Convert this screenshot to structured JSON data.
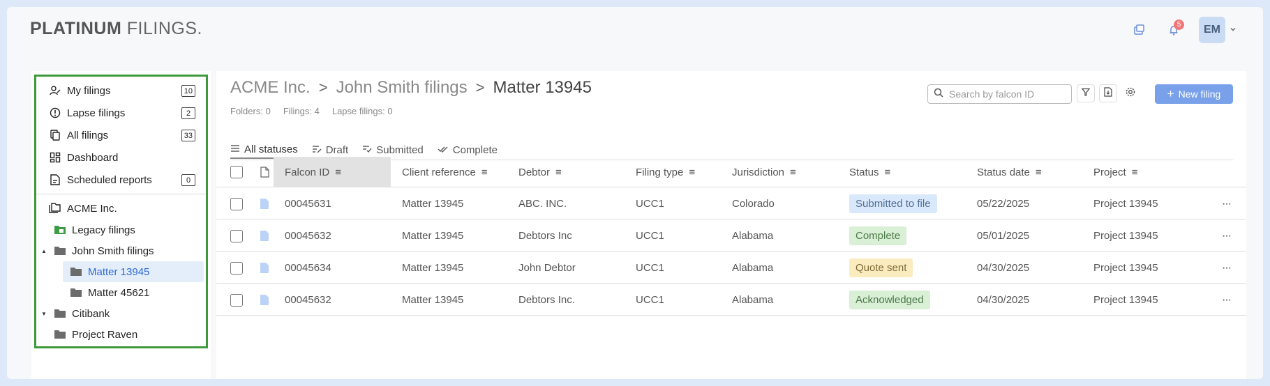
{
  "brand": {
    "bold": "PLATINUM",
    "light": "FILINGS",
    "dot": "."
  },
  "header": {
    "notification_count": "5",
    "avatar_initials": "EM"
  },
  "sidebar": {
    "nav": [
      {
        "label": "My filings",
        "count": "10",
        "icon": "user-edit-icon"
      },
      {
        "label": "Lapse filings",
        "count": "2",
        "icon": "alert-circle-icon"
      },
      {
        "label": "All filings",
        "count": "33",
        "icon": "copy-icon"
      },
      {
        "label": "Dashboard",
        "count": "",
        "icon": "grid-icon"
      },
      {
        "label": "Scheduled reports",
        "count": "0",
        "icon": "report-icon"
      }
    ],
    "tree": [
      {
        "label": "ACME Inc.",
        "icon": "folders-icon"
      },
      {
        "label": "Legacy filings",
        "icon": "folder-green-icon"
      },
      {
        "label": "John Smith filings",
        "icon": "folder-icon",
        "caret": "▲"
      },
      {
        "label": "Matter 13945",
        "icon": "folder-icon",
        "selected": true
      },
      {
        "label": "Matter 45621",
        "icon": "folder-icon"
      },
      {
        "label": "Citibank",
        "icon": "folder-icon",
        "caret": "▼"
      },
      {
        "label": "Project Raven",
        "icon": "folder-icon"
      }
    ]
  },
  "breadcrumb": {
    "first": "ACME Inc.",
    "second": "John Smith filings",
    "current": "Matter 13945",
    "separator": ">"
  },
  "meta": {
    "folders": "Folders: 0",
    "filings": "Filings: 4",
    "lapse": "Lapse filings: 0"
  },
  "search": {
    "placeholder": "Search by falcon ID"
  },
  "new_button": {
    "plus": "+",
    "label": "New filing"
  },
  "tabs": [
    "All statuses",
    "Draft",
    "Submitted",
    "Complete"
  ],
  "columns": [
    "Falcon ID",
    "Client reference",
    "Debtor",
    "Filing type",
    "Jurisdiction",
    "Status",
    "Status date",
    "Project"
  ],
  "rows": [
    {
      "id": "00045631",
      "ref": "Matter 13945",
      "debtor": "ABC. INC.",
      "type": "UCC1",
      "juris": "Colorado",
      "status": "Submitted to file",
      "date": "05/22/2025",
      "project": "Project 13945",
      "more": "···"
    },
    {
      "id": "00045632",
      "ref": "Matter 13945",
      "debtor": "Debtors Inc",
      "type": "UCC1",
      "juris": "Alabama",
      "status": "Complete",
      "date": "05/01/2025",
      "project": "Project 13945",
      "more": "···"
    },
    {
      "id": "00045634",
      "ref": "Matter 13945",
      "debtor": "John Debtor",
      "type": "UCC1",
      "juris": "Alabama",
      "status": "Quote sent",
      "date": "04/30/2025",
      "project": "Project 13945",
      "more": "···"
    },
    {
      "id": "00045632",
      "ref": "Matter 13945",
      "debtor": "Debtors Inc.",
      "type": "UCC1",
      "juris": "Alabama",
      "status": "Acknowledged",
      "date": "04/30/2025",
      "project": "Project 13945",
      "more": "···"
    }
  ],
  "status_colors": {
    "submitted": {
      "bg": "#d9e8fb",
      "fg": "#4f6f95"
    },
    "complete": {
      "bg": "#d9efd6",
      "fg": "#4d7a4a"
    },
    "quote": {
      "bg": "#fbecc0",
      "fg": "#7d6a35"
    },
    "acknowledged": {
      "bg": "#d9efd6",
      "fg": "#4d7a4a"
    }
  },
  "accent": "#79a1ea",
  "highlight_border": "#3d9a3a"
}
